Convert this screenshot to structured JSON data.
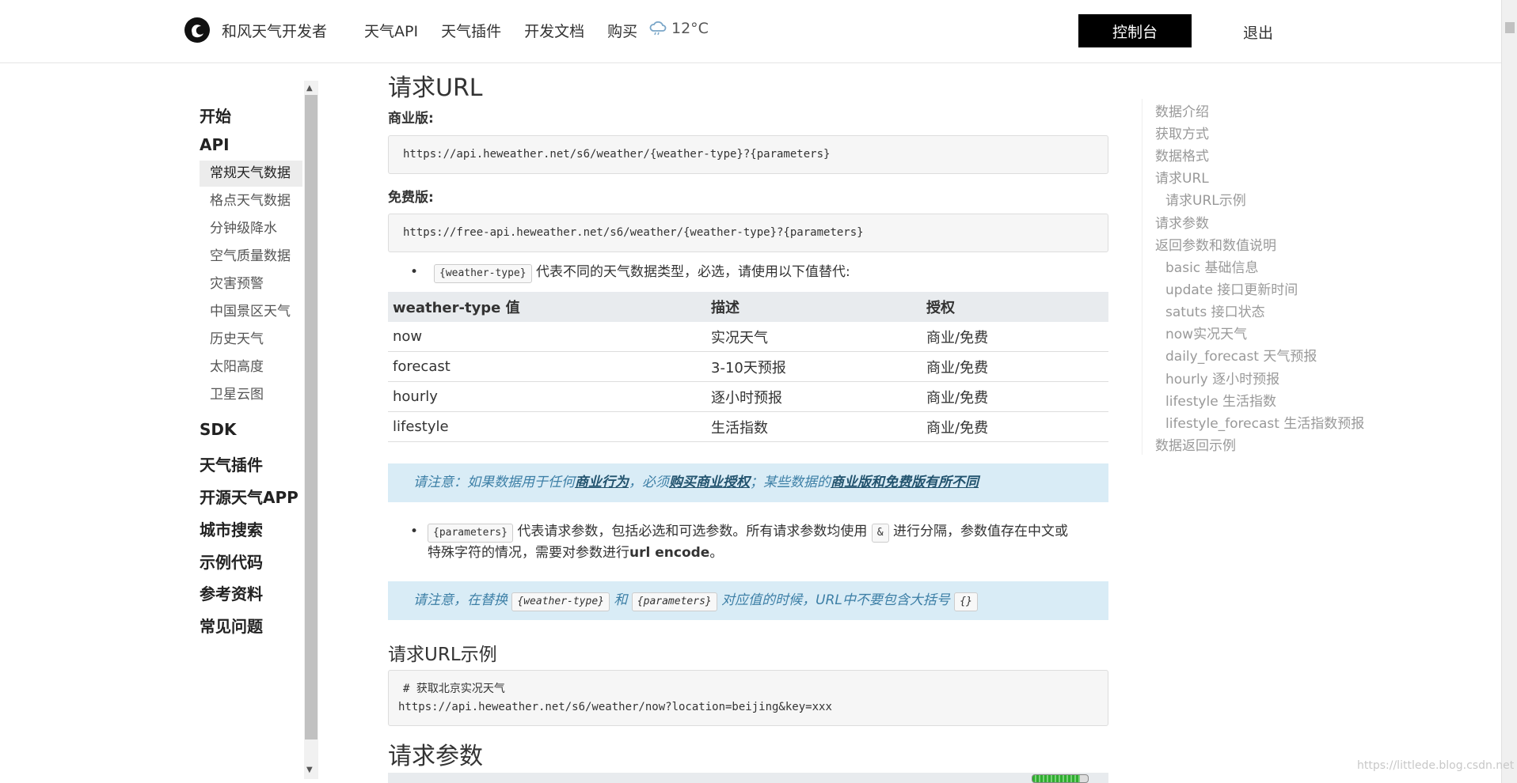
{
  "header": {
    "brand": "和风天气开发者",
    "nav": [
      "天气API",
      "天气插件",
      "开发文档",
      "购买"
    ],
    "weather_temp": "12°C",
    "console_label": "控制台",
    "logout_label": "退出"
  },
  "sidebar": {
    "start": "开始",
    "api": "API",
    "api_items": [
      "常规天气数据",
      "格点天气数据",
      "分钟级降水",
      "空气质量数据",
      "灾害预警",
      "中国景区天气",
      "历史天气",
      "太阳高度",
      "卫星云图"
    ],
    "active_item": "常规天气数据",
    "categories": [
      "SDK",
      "天气插件",
      "开源天气APP",
      "城市搜索",
      "示例代码",
      "参考资料",
      "常见问题"
    ]
  },
  "main": {
    "section_title": "请求URL",
    "commercial_label": "商业版:",
    "commercial_url": "https://api.heweather.net/s6/weather/{weather-type}?{parameters}",
    "free_label": "免费版:",
    "free_url": "https://free-api.heweather.net/s6/weather/{weather-type}?{parameters}",
    "bullet1_code": "{weather-type}",
    "bullet1_text": "代表不同的天气数据类型，必选，请使用以下值替代:",
    "table_headers": [
      "weather-type 值",
      "描述",
      "授权"
    ],
    "table_rows": [
      [
        "now",
        "实况天气",
        "商业/免费"
      ],
      [
        "forecast",
        "3-10天预报",
        "商业/免费"
      ],
      [
        "hourly",
        "逐小时预报",
        "商业/免费"
      ],
      [
        "lifestyle",
        "生活指数",
        "商业/免费"
      ]
    ],
    "note1": {
      "t1": "请注意：如果数据用于任何",
      "b1": "商业行为",
      "t2": "，必须",
      "b2": "购买商业授权",
      "t3": "；某些数据的",
      "b3": "商业版和免费版有所不同"
    },
    "bullet2_code": "{parameters}",
    "bullet2_text1": "代表请求参数，包括必选和可选参数。所有请求参数均使用",
    "bullet2_amp": "&",
    "bullet2_text2": "进行分隔，参数值存在中文或",
    "bullet2_text3": "特殊字符的情况，需要对参数进行",
    "bullet2_bold": "url encode",
    "bullet2_end": "。",
    "note2": {
      "t1": "请注意，在替换",
      "c1": "{weather-type}",
      "t2": "和",
      "c2": "{parameters}",
      "t3": "对应值的时候，URL中不要包含大括号",
      "c3": "{}"
    },
    "example_title": "请求URL示例",
    "example_comment": "# 获取北京实况天气",
    "example_url": "https://api.heweather.net/s6/weather/now?location=beijing&key=xxx",
    "params_title": "请求参数"
  },
  "toc": {
    "items": [
      "数据介绍",
      "获取方式",
      "数据格式",
      "请求URL",
      "请求URL示例",
      "请求参数",
      "返回参数和数值说明",
      "basic 基础信息",
      "update 接口更新时间",
      "satuts 接口状态",
      "now实况天气",
      "daily_forecast 天气预报",
      "hourly 逐小时预报",
      "lifestyle 生活指数",
      "lifestyle_forecast 生活指数预报",
      "数据返回示例"
    ]
  },
  "watermark": "https://littlede.blog.csdn.net",
  "progress_fraction": 0.85,
  "colors": {
    "accent": "#000000",
    "note_bg": "#d9ecf6",
    "note_text": "#3d7fa6",
    "toc_text": "#999999"
  }
}
